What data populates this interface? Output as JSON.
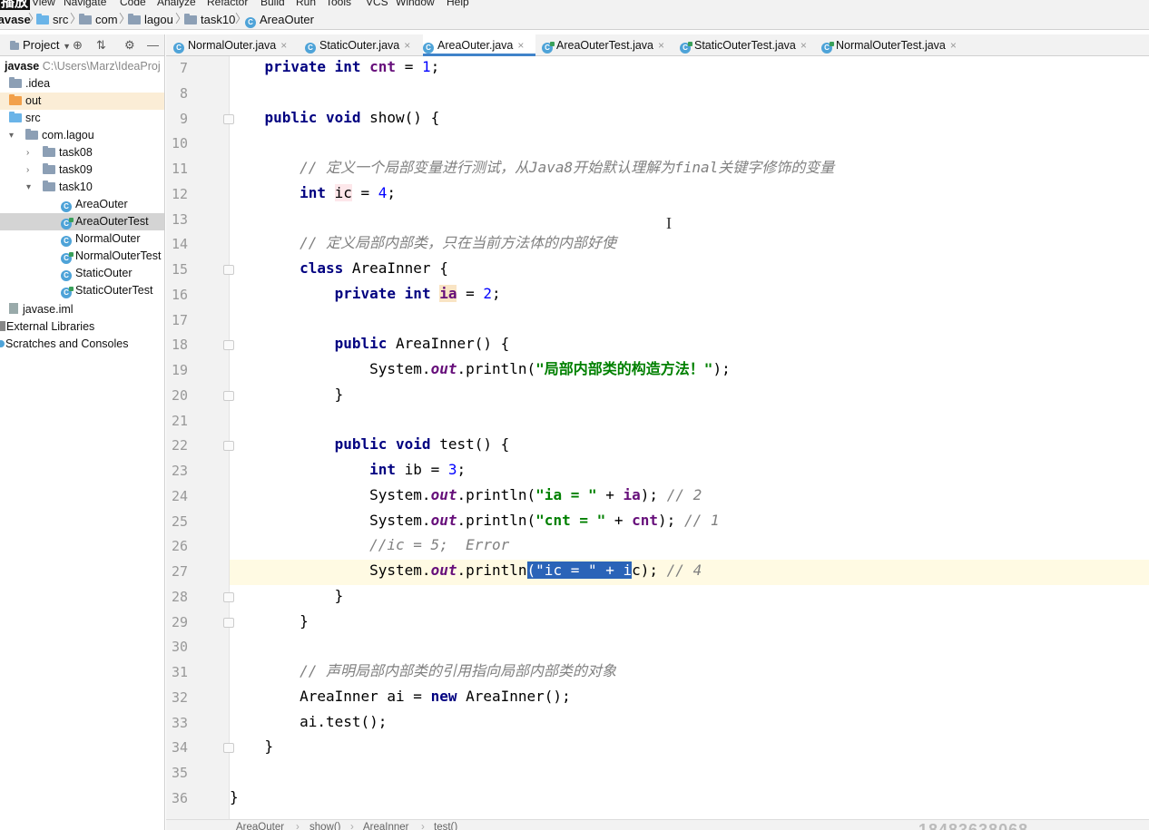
{
  "watermark_top": "播放",
  "menu": {
    "items": [
      "View",
      "Navigate",
      "Code",
      "Analyze",
      "Refactor",
      "Build",
      "Run",
      "Tools",
      "VCS",
      "Window",
      "Help"
    ]
  },
  "breadcrumb": {
    "project": "javase",
    "parts": [
      "src",
      "com",
      "lagou",
      "task10",
      "AreaOuter"
    ]
  },
  "project_panel": {
    "title": "Project",
    "tree": [
      {
        "label": "javase",
        "path": "C:\\Users\\Marz\\IdeaProj",
        "icon": "folder"
      },
      {
        "label": ".idea",
        "icon": "folder"
      },
      {
        "label": "out",
        "icon": "folder-orange"
      },
      {
        "label": "src",
        "icon": "folder-blue"
      },
      {
        "label": "com.lagou",
        "icon": "package"
      },
      {
        "label": "task08",
        "icon": "package"
      },
      {
        "label": "task09",
        "icon": "package"
      },
      {
        "label": "task10",
        "icon": "package"
      },
      {
        "label": "AreaOuter",
        "icon": "class"
      },
      {
        "label": "AreaOuterTest",
        "icon": "test-class"
      },
      {
        "label": "NormalOuter",
        "icon": "class"
      },
      {
        "label": "NormalOuterTest",
        "icon": "test-class"
      },
      {
        "label": "StaticOuter",
        "icon": "class"
      },
      {
        "label": "StaticOuterTest",
        "icon": "test-class"
      },
      {
        "label": "javase.iml",
        "icon": "file"
      },
      {
        "label": "External Libraries",
        "icon": "library"
      },
      {
        "label": "Scratches and Consoles",
        "icon": "scratch"
      }
    ]
  },
  "tabs": [
    {
      "label": "NormalOuter.java",
      "active": false
    },
    {
      "label": "StaticOuter.java",
      "active": false
    },
    {
      "label": "AreaOuter.java",
      "active": true
    },
    {
      "label": "AreaOuterTest.java",
      "active": false
    },
    {
      "label": "StaticOuterTest.java",
      "active": false
    },
    {
      "label": "NormalOuterTest.java",
      "active": false
    }
  ],
  "editor": {
    "current_line": 27,
    "line_numbers": [
      "7",
      "8",
      "9",
      "10",
      "11",
      "12",
      "13",
      "14",
      "15",
      "16",
      "17",
      "18",
      "19",
      "20",
      "21",
      "22",
      "23",
      "24",
      "25",
      "26",
      "27",
      "28",
      "29",
      "30",
      "31",
      "32",
      "33",
      "34",
      "35",
      "36"
    ],
    "lines": [
      "    private int cnt = 1;",
      "",
      "    public void show() {",
      "",
      "        // 定义一个局部变量进行测试，从Java8开始默认理解为final关键字修饰的变量",
      "        int ic = 4;",
      "",
      "        // 定义局部内部类，只在当前方法体的内部好使",
      "        class AreaInner {",
      "            private int ia = 2;",
      "",
      "            public AreaInner() {",
      "                System.out.println(\"局部内部类的构造方法！\");",
      "            }",
      "",
      "            public void test() {",
      "                int ib = 3;",
      "                System.out.println(\"ia = \" + ia); // 2",
      "                System.out.println(\"cnt = \" + cnt); // 1",
      "                //ic = 5;  Error",
      "                System.out.println(\"ic = \" + ic); // 4",
      "            }",
      "        }",
      "",
      "        // 声明局部内部类的引用指向局部内部类的对象",
      "        AreaInner ai = new AreaInner();",
      "        ai.test();",
      "    }",
      "",
      "}"
    ]
  },
  "status_breadcrumb": [
    "AreaOuter",
    "show()",
    "AreaInner",
    "test()"
  ],
  "watermark_bottom": "18483638068"
}
